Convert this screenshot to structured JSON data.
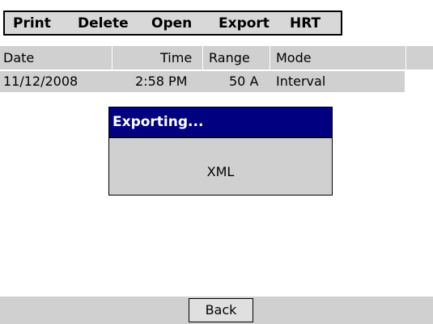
{
  "menu": {
    "print": "Print",
    "delete": "Delete",
    "open": "Open",
    "export": "Export",
    "hrt": "HRT"
  },
  "table": {
    "headers": [
      "Date",
      "Time",
      "Range",
      "Mode"
    ],
    "rows": [
      [
        "11/12/2008",
        "2:58 PM",
        "50 A",
        "Interval"
      ]
    ]
  },
  "dialog": {
    "title": "Exporting...",
    "body": "XML"
  },
  "footer": {
    "back_label": "Back"
  },
  "colors": {
    "dialog_title_bg": "#000080",
    "panel_gray": "#d0d0d0"
  }
}
